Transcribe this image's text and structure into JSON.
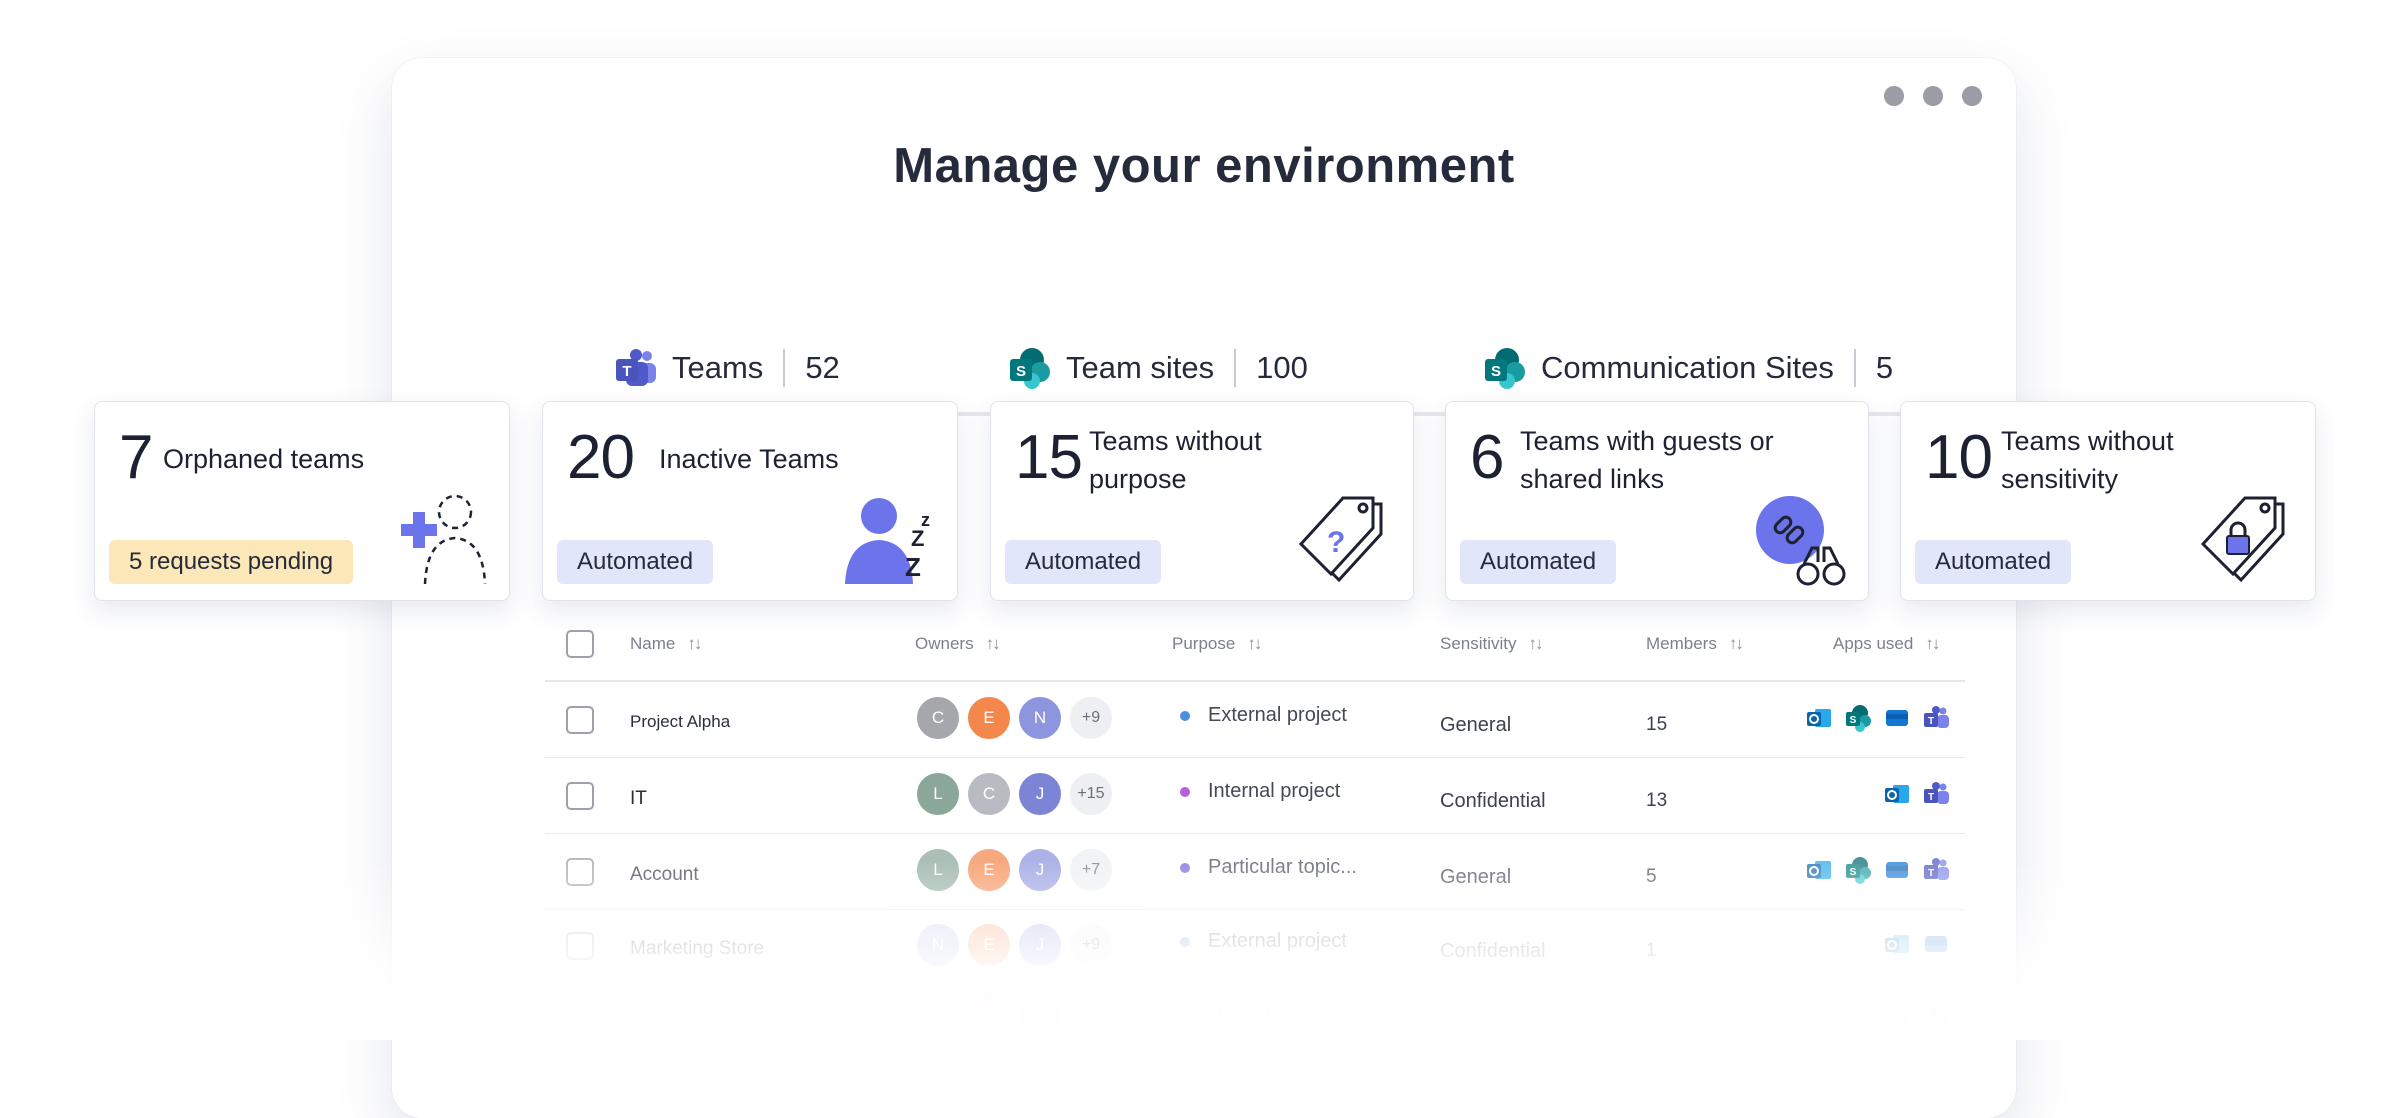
{
  "window": {
    "title": "Manage your environment"
  },
  "tabs": [
    {
      "label": "Teams",
      "count": "52",
      "icon": "teams-icon"
    },
    {
      "label": "Team sites",
      "count": "100",
      "icon": "sharepoint-icon"
    },
    {
      "label": "Communication Sites",
      "count": "5",
      "icon": "sharepoint-icon"
    }
  ],
  "cards": [
    {
      "num": "7",
      "label": "Orphaned teams",
      "pill": "5 requests pending",
      "icon": "orphaned-user-icon"
    },
    {
      "num": "20",
      "label": "Inactive Teams",
      "pill": "Automated",
      "icon": "sleeping-user-icon"
    },
    {
      "num": "15",
      "label": "Teams without purpose",
      "pill": "Automated",
      "icon": "question-tag-icon"
    },
    {
      "num": "6",
      "label": "Teams with guests or shared links",
      "pill": "Automated",
      "icon": "link-binoculars-icon"
    },
    {
      "num": "10",
      "label": "Teams without sensitivity",
      "pill": "Automated",
      "icon": "lock-tag-icon"
    }
  ],
  "table": {
    "headers": {
      "name": "Name",
      "owners": "Owners",
      "purpose": "Purpose",
      "sensitivity": "Sensitivity",
      "members": "Members",
      "apps": "Apps used"
    },
    "rows": [
      {
        "name": "Project Alpha",
        "owners": [
          "C",
          "E",
          "N"
        ],
        "more": "+9",
        "purpose": "External project",
        "purpose_color": "#4a90e2",
        "sensitivity": "General",
        "members": "15",
        "apps": [
          "outlook",
          "sharepoint",
          "planner",
          "teams"
        ]
      },
      {
        "name": "IT",
        "owners": [
          "L",
          "C",
          "J"
        ],
        "more": "+15",
        "purpose": "Internal project",
        "purpose_color": "#b65ee0",
        "sensitivity": "Confidential",
        "members": "13",
        "apps": [
          "outlook",
          "teams"
        ]
      },
      {
        "name": "Account",
        "owners": [
          "L",
          "E",
          "J"
        ],
        "more": "+7",
        "purpose": "Particular topic...",
        "purpose_color": "#6f64d8",
        "sensitivity": "General",
        "members": "5",
        "apps": [
          "outlook",
          "sharepoint",
          "planner",
          "teams"
        ]
      },
      {
        "name": "Marketing Store",
        "owners": [
          "N",
          "E",
          "J"
        ],
        "more": "+9",
        "purpose": "External project",
        "purpose_color": "#4a90e2",
        "sensitivity": "Confidential",
        "members": "1",
        "apps": [
          "outlook",
          "planner"
        ]
      },
      {
        "name": "London office",
        "owners": [
          "L",
          "E",
          "C"
        ],
        "more": "+18",
        "purpose": "Office location",
        "purpose_color": "#6f64d8",
        "sensitivity": "Confidential",
        "members": "4",
        "apps": [
          "outlook",
          "teams"
        ]
      }
    ]
  },
  "colors": {
    "accent": "#5a64e8",
    "avatar_gray": "#a5a7ad",
    "avatar_orange": "#f4874b",
    "avatar_purple": "#8d95de",
    "avatar_green": "#8aa79a",
    "pill_pending": "#fce7b9",
    "pill_automated": "#e2e6fb"
  }
}
